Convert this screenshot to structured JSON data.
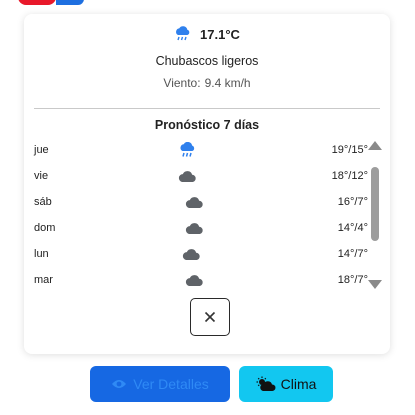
{
  "current": {
    "icon": "rain-cloud-icon",
    "temperature": "17.1°C",
    "condition": "Chubascos ligeros",
    "wind_label": "Viento:",
    "wind_value": "9.4 km/h"
  },
  "forecast": {
    "title": "Pronóstico 7 días",
    "days": [
      {
        "day": "jue",
        "icon": "rain-cloud-icon",
        "temps": "19°/15°"
      },
      {
        "day": "vie",
        "icon": "cloud-icon",
        "temps": "18°/12°"
      },
      {
        "day": "sáb",
        "icon": "cloud-icon",
        "temps": "16°/7°"
      },
      {
        "day": "dom",
        "icon": "cloud-icon",
        "temps": "14°/4°"
      },
      {
        "day": "lun",
        "icon": "cloud-icon",
        "temps": "14°/7°"
      },
      {
        "day": "mar",
        "icon": "cloud-icon",
        "temps": "18°/7°"
      }
    ]
  },
  "buttons": {
    "close_icon": "close-icon",
    "details_label": "Ver Detalles",
    "details_icon": "eye-icon",
    "clima_label": "Clima",
    "clima_icon": "cloud-sun-icon"
  },
  "colors": {
    "rain_icon": "#2f80ed",
    "cloud_icon": "#5f6368",
    "details_bg": "#1668e3",
    "clima_bg": "#12c7f0"
  }
}
